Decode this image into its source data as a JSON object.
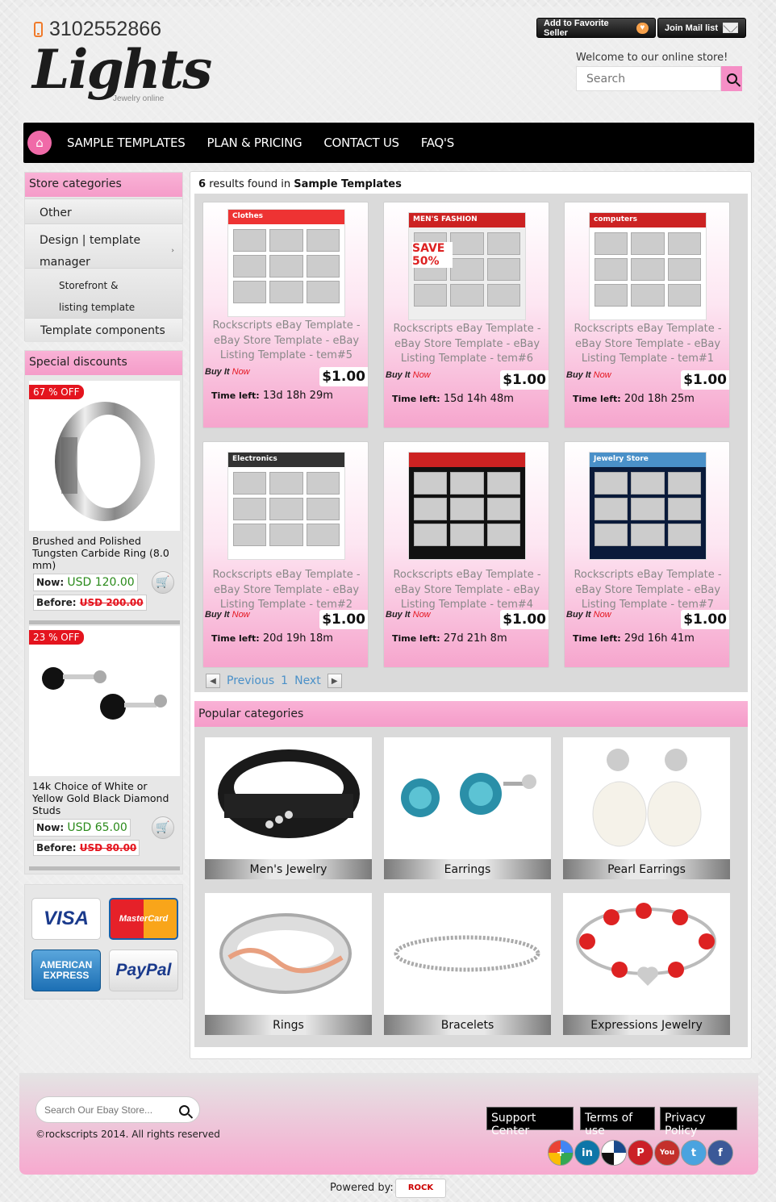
{
  "header": {
    "phone": "3102552866",
    "logo": "Lights",
    "logo_sub": "Jewelry online",
    "add_favorite": "Add to Favorite Seller",
    "join_mail": "Join Mail list",
    "welcome": "Welcome to our online store!",
    "search_placeholder": "Search"
  },
  "nav": {
    "items": [
      "SAMPLE TEMPLATES",
      "PLAN & PRICING",
      "CONTACT US",
      "FAQ'S"
    ]
  },
  "sidebar": {
    "categories_title": "Store categories",
    "categories": [
      "Other",
      "Design | template manager",
      "Storefront & listing template",
      "Template components"
    ],
    "discounts_title": "Special discounts",
    "discounts": [
      {
        "badge": "67 % OFF",
        "name": "Brushed and Polished Tungsten Carbide Ring (8.0 mm)",
        "now_label": "Now:",
        "now": "USD 120.00",
        "before_label": "Before:",
        "before": "USD 200.00"
      },
      {
        "badge": "23 % OFF",
        "name": "14k Choice of White or Yellow Gold Black Diamond Studs",
        "now_label": "Now:",
        "now": "USD 65.00",
        "before_label": "Before:",
        "before": "USD 80.00"
      }
    ],
    "payments": [
      "VISA",
      "MasterCard",
      "AMERICAN EXPRESS",
      "PayPal"
    ]
  },
  "results": {
    "count": "6",
    "text": "results found in",
    "category": "Sample Templates"
  },
  "listings": [
    {
      "title": "Rockscripts eBay Template - eBay Store Template - eBay Listing Template - tem#5",
      "bin1": "Buy It",
      "bin2": "Now",
      "price": "$1.00",
      "time_label": "Time left:",
      "time": "13d 18h 29m"
    },
    {
      "title": "Rockscripts eBay Template - eBay Store Template - eBay Listing Template - tem#6",
      "bin1": "Buy It",
      "bin2": "Now",
      "price": "$1.00",
      "time_label": "Time left:",
      "time": "15d 14h 48m"
    },
    {
      "title": "Rockscripts eBay Template - eBay Store Template - eBay Listing Template - tem#1",
      "bin1": "Buy It",
      "bin2": "Now",
      "price": "$1.00",
      "time_label": "Time left:",
      "time": "20d 18h 25m"
    },
    {
      "title": "Rockscripts eBay Template - eBay Store Template - eBay Listing Template - tem#2",
      "bin1": "Buy It",
      "bin2": "Now",
      "price": "$1.00",
      "time_label": "Time left:",
      "time": "20d 19h 18m"
    },
    {
      "title": "Rockscripts eBay Template - eBay Store Template - eBay Listing Template - tem#4",
      "bin1": "Buy It",
      "bin2": "Now",
      "price": "$1.00",
      "time_label": "Time left:",
      "time": "27d 21h 8m"
    },
    {
      "title": "Rockscripts eBay Template - eBay Store Template - eBay Listing Template - tem#7",
      "bin1": "Buy It",
      "bin2": "Now",
      "price": "$1.00",
      "time_label": "Time left:",
      "time": "29d 16h 41m"
    }
  ],
  "thumb_labels": [
    "Clothes",
    "MEN'S FASHION",
    "computers",
    "Electronics",
    "",
    "Jewelry Store"
  ],
  "thumb_save": "SAVE 50%",
  "pager": {
    "previous": "Previous",
    "page": "1",
    "next": "Next"
  },
  "popular": {
    "title": "Popular categories",
    "items": [
      "Men's Jewelry",
      "Earrings",
      "Pearl Earrings",
      "Rings",
      "Bracelets",
      "Expressions Jewelry"
    ]
  },
  "footer": {
    "search_placeholder": "Search Our Ebay Store...",
    "copyright": "©rockscripts 2014. All rights reserved",
    "links": [
      "Support Center",
      "Terms of use",
      "Privacy Policy"
    ],
    "social": [
      "google-plus",
      "linkedin",
      "digg",
      "pinterest",
      "youtube",
      "twitter",
      "facebook"
    ],
    "powered_by": "Powered by:",
    "powered_logo": "ROCK"
  },
  "colors": {
    "accent_pink": "#f59cc9",
    "nav_bg": "#000000",
    "badge_red": "#e4141e",
    "price_green": "#2a8a1a"
  }
}
